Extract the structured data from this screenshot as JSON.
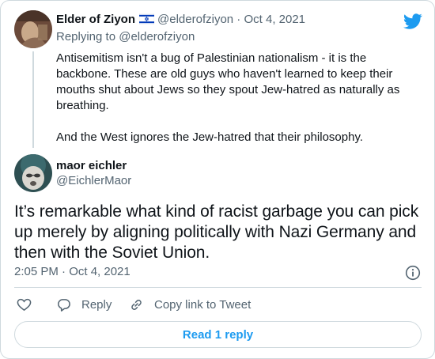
{
  "colors": {
    "accent": "#1d9bf0",
    "muted": "#536471",
    "text": "#0f1419",
    "border": "#cfd9de"
  },
  "icons": [
    "twitter-bird-icon",
    "israel-flag-icon",
    "info-icon",
    "heart-icon",
    "reply-icon",
    "link-icon"
  ],
  "parent_tweet": {
    "author_name": "Elder of Ziyon",
    "author_handle": "@elderofziyon",
    "separator": "·",
    "date": "Oct 4, 2021",
    "replying_prefix": "Replying to ",
    "replying_to": "@elderofziyon",
    "paragraphs": [
      "Antisemitism isn't a bug of Palestinian nationalism - it is the backbone. These are old guys who haven't learned to keep their mouths shut about Jews so they spout Jew-hatred as naturally as breathing.",
      "And the West ignores the Jew-hatred that their philosophy."
    ]
  },
  "tweet": {
    "author_name": "maor eichler",
    "author_handle": "@EichlerMaor",
    "text": "It’s remarkable what kind of racist garbage you can pick up merely by aligning politically with Nazi Germany and then with the Soviet Union.",
    "timestamp": "2:05 PM · Oct 4, 2021"
  },
  "actions": {
    "reply_label": "Reply",
    "copy_link_label": "Copy link to Tweet"
  },
  "read_replies_label": "Read 1 reply"
}
